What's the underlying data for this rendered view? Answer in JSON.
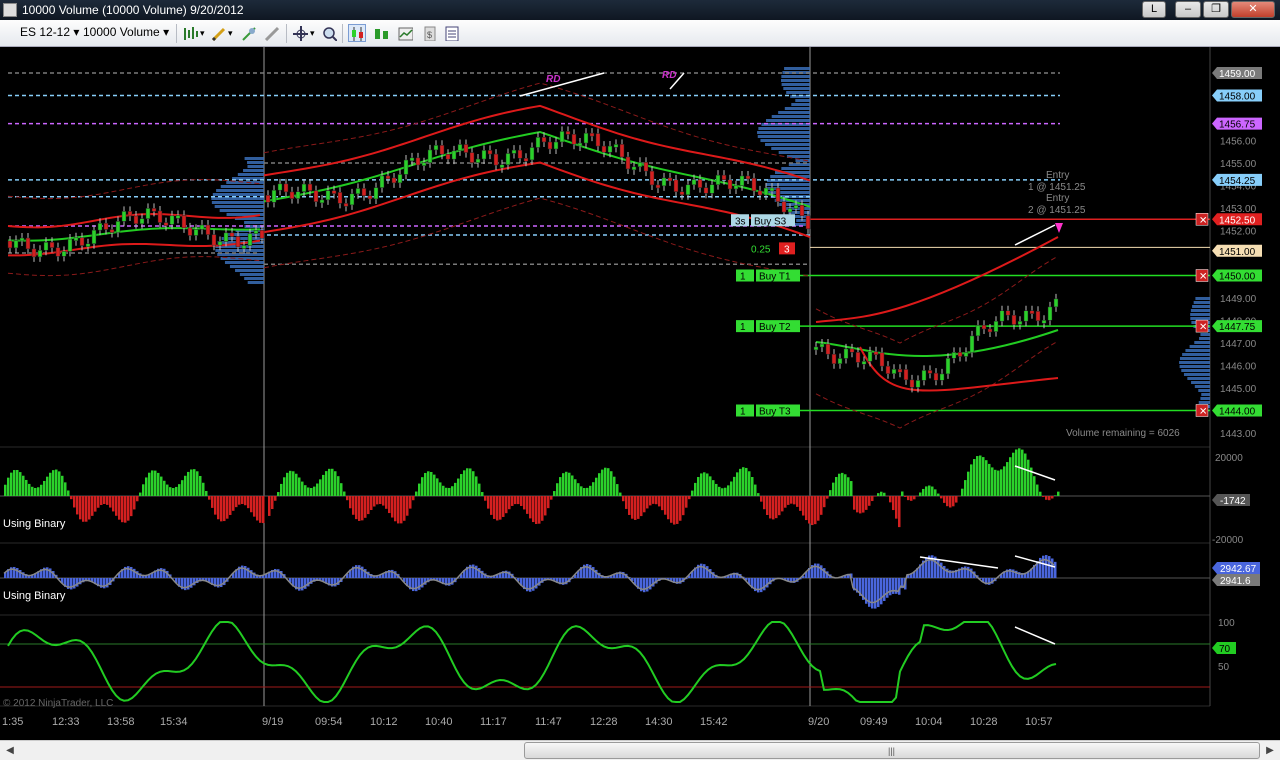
{
  "window": {
    "title": "10000 Volume (10000 Volume)  9/20/2012",
    "buttons": {
      "language": "L",
      "minimize": "–",
      "restore": "❐",
      "close": "✕"
    }
  },
  "toolbar": {
    "instrument": "ES 12-12",
    "period": "10000 Volume",
    "icons": [
      "bar-type-icon",
      "drawing-pencil-icon",
      "draw-object-icon",
      "eraser-icon",
      "crosshair-icon",
      "zoom-icon",
      "chart-style-candle-icon",
      "chart-style-bar-icon",
      "data-box-icon",
      "strategy-icon",
      "properties-icon"
    ]
  },
  "price_panel": {
    "axis_ticks": [
      "1459.00",
      "1458.00",
      "1456.75",
      "1456.00",
      "1455.00",
      "1454.25",
      "1454.00",
      "1453.00",
      "1452.50",
      "1452.00",
      "1451.00",
      "1450.00",
      "1449.00",
      "1448.00",
      "1447.75",
      "1447.00",
      "1446.00",
      "1445.00",
      "1444.00",
      "1443.00"
    ],
    "labels": {
      "rd": "RD",
      "entry1": "Entry",
      "entry1_detail": "1 @ 1451.25",
      "entry2": "Entry",
      "entry2_detail": "2 @ 1451.25",
      "volume_remaining": "Volume remaining = 6026"
    },
    "price_flags": [
      {
        "text": "1459.00",
        "bg": "#7a7a7a",
        "fg": "#ffffff"
      },
      {
        "text": "1458.00",
        "bg": "#87cefa",
        "fg": "#000000"
      },
      {
        "text": "1456.75",
        "bg": "#cc66ff",
        "fg": "#000000"
      },
      {
        "text": "1454.25",
        "bg": "#87cefa",
        "fg": "#000000"
      },
      {
        "text": "1452.50",
        "bg": "#e02020",
        "fg": "#ffffff"
      },
      {
        "text": "1451.00",
        "bg": "#f5deb3",
        "fg": "#000000"
      },
      {
        "text": "1450.00",
        "bg": "#33dd33",
        "fg": "#000000"
      },
      {
        "text": "1447.75",
        "bg": "#33dd33",
        "fg": "#000000"
      },
      {
        "text": "1444.00",
        "bg": "#33dd33",
        "fg": "#000000"
      }
    ],
    "orders": [
      {
        "qty": "3s",
        "name": "Buy S3",
        "style": "stop"
      },
      {
        "qty": "0.25",
        "name": "3",
        "style": "position"
      },
      {
        "qty": "1",
        "name": "Buy T1",
        "style": "target"
      },
      {
        "qty": "1",
        "name": "Buy T2",
        "style": "target"
      },
      {
        "qty": "1",
        "name": "Buy T3",
        "style": "target"
      }
    ]
  },
  "indicator1": {
    "label": "Using Binary",
    "ticks": [
      "20000",
      "-20000"
    ],
    "value_flag": "-1742"
  },
  "indicator2": {
    "label": "Using Binary",
    "value_flag_top": "2942.67",
    "value_flag": "2941.6"
  },
  "indicator3": {
    "ticks": [
      "100",
      "50"
    ],
    "value_flag": "70"
  },
  "copyright": "© 2012 NinjaTrader, LLC",
  "time_axis": [
    "1:35",
    "12:33",
    "13:58",
    "15:34",
    "9/19",
    "09:54",
    "10:12",
    "10:40",
    "11:17",
    "11:47",
    "12:28",
    "14:30",
    "15:42",
    "9/20",
    "09:49",
    "10:04",
    "10:28",
    "10:57"
  ],
  "colors": {
    "up_bar": "#2bd12b",
    "down_bar": "#d42020",
    "level_green": "#22dd22",
    "level_red": "#dd2020",
    "ma_green": "#22cc22",
    "ma_red": "#dd1a1a",
    "blue_hist": "#4a66dd",
    "volume_profile": "#3a6eb8"
  }
}
